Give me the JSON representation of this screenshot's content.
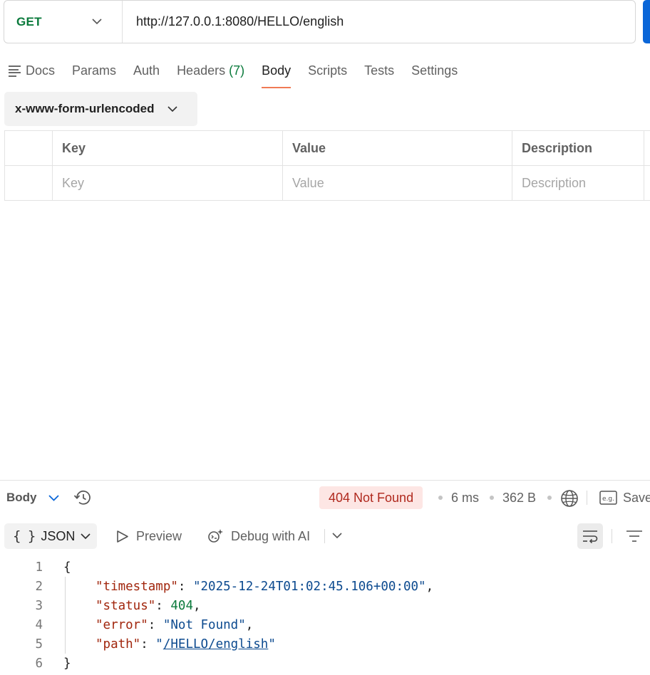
{
  "request": {
    "method": "GET",
    "url": "http://127.0.0.1:8080/HELLO/english"
  },
  "tabs": [
    {
      "label": "Docs",
      "icon": "lines-icon"
    },
    {
      "label": "Params"
    },
    {
      "label": "Auth"
    },
    {
      "label": "Headers",
      "count": "(7)"
    },
    {
      "label": "Body",
      "active": true
    },
    {
      "label": "Scripts"
    },
    {
      "label": "Tests"
    },
    {
      "label": "Settings"
    }
  ],
  "body_type": "x-www-form-urlencoded",
  "kv_table": {
    "headers": [
      "Key",
      "Value",
      "Description"
    ],
    "placeholders": [
      "Key",
      "Value",
      "Description"
    ]
  },
  "response": {
    "title": "Body",
    "status": "404 Not Found",
    "time": "6 ms",
    "size": "362 B",
    "save_label": "Save",
    "format": "JSON",
    "preview_label": "Preview",
    "debug_label": "Debug with AI",
    "lines": [
      {
        "num": "1",
        "text": "{"
      },
      {
        "num": "2",
        "key": "\"timestamp\"",
        "value": "\"2025-12-24T01:02:45.106+00:00\"",
        "suffix": ","
      },
      {
        "num": "3",
        "key": "\"status\"",
        "value": "404",
        "suffix": ","
      },
      {
        "num": "4",
        "key": "\"error\"",
        "value": "\"Not Found\"",
        "suffix": ","
      },
      {
        "num": "5",
        "key": "\"path\"",
        "value_q1": "\"",
        "value_link": "/HELLO/english",
        "value_q2": "\""
      },
      {
        "num": "6",
        "text": "}"
      }
    ]
  },
  "colors": {
    "method_get": "#0b7a3c",
    "active_tab_underline": "#f07a55",
    "status_bg": "#fde6e4",
    "status_text": "#b0291e",
    "json_key": "#a1260d",
    "json_string": "#0c4a8f",
    "json_number": "#0b7a3c",
    "send_button": "#0a66d8"
  }
}
